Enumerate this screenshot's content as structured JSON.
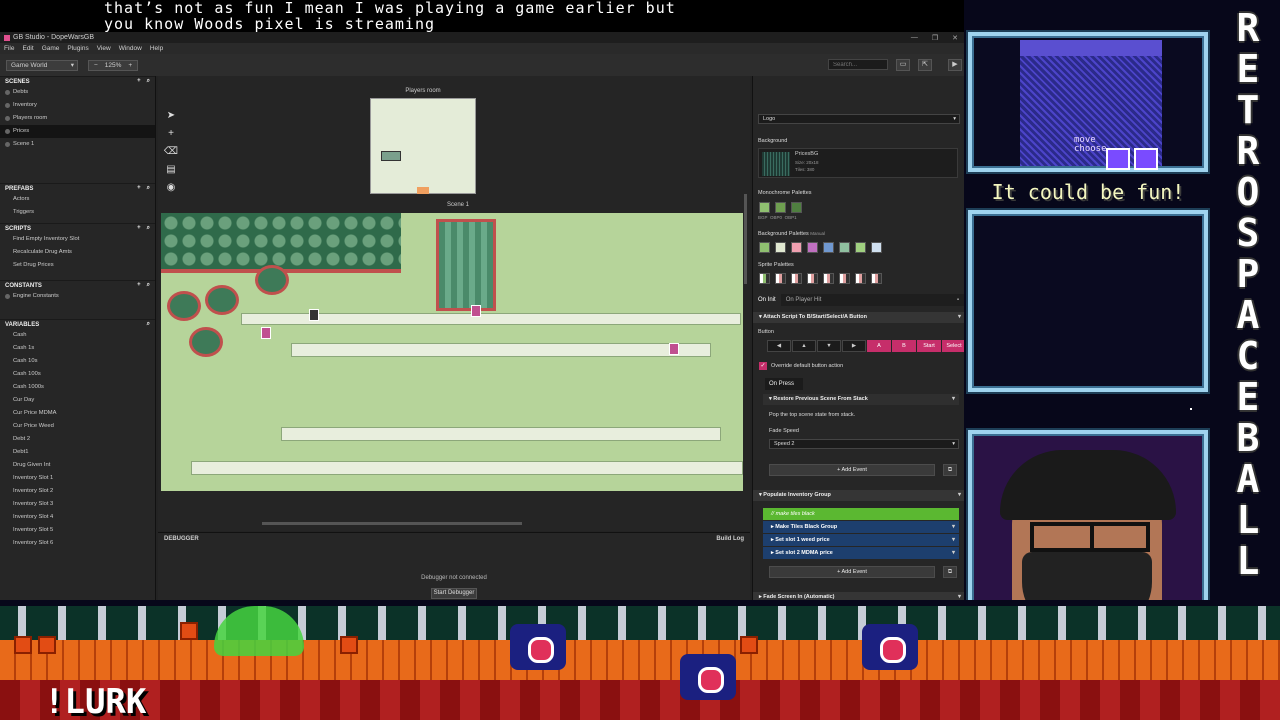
{
  "overlay": {
    "caption_line1": "that’s not as fun I mean I was playing a game earlier but",
    "caption_line2": "you know Woods pixel is streaming",
    "side_title": [
      "R",
      "E",
      "T",
      "R",
      "O",
      "S",
      "P",
      "A",
      "C",
      "E",
      "B",
      "A",
      "L",
      "L"
    ],
    "fun_text": "It could be fun!",
    "mini_game_text1": "move",
    "mini_game_text2": "choose",
    "lurk": "!LURK"
  },
  "app": {
    "title": "GB Studio - DopeWarsGB",
    "menu": [
      "File",
      "Edit",
      "Game",
      "Plugins",
      "View",
      "Window",
      "Help"
    ],
    "window_controls": [
      "—",
      "❐",
      "✕"
    ],
    "toolbar": {
      "view_select": "Game World",
      "zoom_minus": "−",
      "zoom": "125%",
      "zoom_plus": "+",
      "search_placeholder": "Search...",
      "folder_btn": "▭",
      "export_btn": "⇱",
      "play_btn": "▶"
    },
    "sidebar": {
      "scenes": {
        "title": "SCENES",
        "items": [
          "Debts",
          "Inventory",
          "Players room",
          "Prices",
          "Scene 1"
        ]
      },
      "prefabs": {
        "title": "PREFABS",
        "items": [
          "Actors",
          "Triggers"
        ]
      },
      "scripts": {
        "title": "SCRIPTS",
        "items": [
          "Find Empty Inventory Slot",
          "Recalculate Drug Amts",
          "Set Drug Prices"
        ]
      },
      "constants": {
        "title": "CONSTANTS",
        "items": [
          "Engine Constants"
        ]
      },
      "variables": {
        "title": "VARIABLES",
        "items": [
          "Cash",
          "Cash 1s",
          "Cash 10s",
          "Cash 100s",
          "Cash 1000s",
          "Cur Day",
          "Cur Price MDMA",
          "Cur Price Weed",
          "Debt 2",
          "Debt1",
          "Drug Given Int",
          "Inventory Slot 1",
          "Inventory Slot 2",
          "Inventory Slot 3",
          "Inventory Slot 4",
          "Inventory Slot 5",
          "Inventory Slot 6"
        ]
      }
    },
    "canvas": {
      "room1_label": "Players room",
      "room2_label": "Scene 1",
      "tools": [
        "➤",
        "+",
        "⌫",
        "▤",
        "◉"
      ]
    },
    "debugger": {
      "title": "DEBUGGER",
      "build_log": "Build Log",
      "message": "Debugger not connected",
      "start_button": "Start Debugger"
    },
    "properties": {
      "layer_select": "Logo",
      "background_label": "Background",
      "bg_name": "PricesBG",
      "bg_size": "Size: 20x18",
      "bg_tiles": "Tiles: 380",
      "mono_label": "Monochrome Palettes",
      "mono_names": [
        "BGP",
        "OBP0",
        "OBP1"
      ],
      "bg_pal_label": "Background Palettes",
      "bg_pal_mode": "Manual",
      "sprite_pal_label": "Sprite Palettes",
      "tab_oninit": "On Init",
      "tab_onhit": "On Player Hit",
      "lock_icon": "▪",
      "attach_event": "Attach Script To B/Start/Select/A Button",
      "button_label": "Button",
      "buttons": [
        "◀",
        "▲",
        "▼",
        "▶",
        "A",
        "B",
        "Start",
        "Select"
      ],
      "override_label": "Override default button action",
      "on_press": "On Press",
      "restore_event": "Restore Previous Scene From Stack",
      "restore_desc": "Pop the top scene state from stack.",
      "fade_label": "Fade Speed",
      "fade_value": "Speed 2",
      "add_event": "Add Event",
      "populate_event": "Populate Inventory Group",
      "comment_row": "// make tiles black",
      "sub_events": [
        "Make Tiles Black Group",
        "Set slot 1 weed price",
        "Set slot 2 MDMA price"
      ],
      "fade_in_event": "Fade Screen In (Automatic)"
    }
  }
}
